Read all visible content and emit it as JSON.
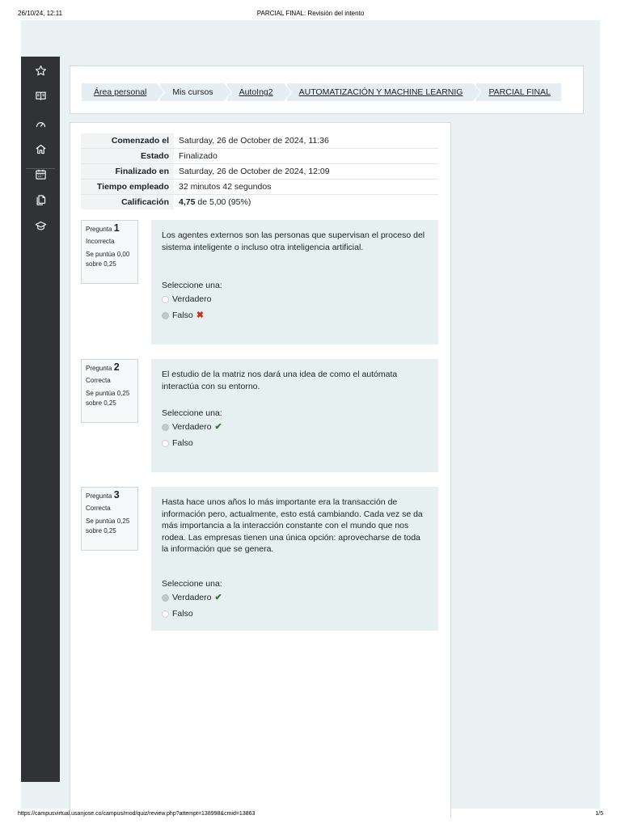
{
  "print_header": {
    "date": "26/10/24, 12:11",
    "title": "PARCIAL FINAL: Revisión del intento"
  },
  "print_footer": {
    "url": "https://campusvirtual.usanjose.co/campus/mod/quiz/review.php?attempt=138998&cmid=13863",
    "page": "1/5"
  },
  "sidebar": {
    "icons": [
      "star-icon",
      "book-icon",
      "speedometer-icon",
      "home-icon",
      "calendar-icon",
      "files-icon",
      "graduation-cap-icon"
    ]
  },
  "breadcrumb": {
    "items": [
      {
        "label": "Área personal",
        "link": true
      },
      {
        "label": "Mis cursos",
        "link": false
      },
      {
        "label": "AutoIng2",
        "link": true
      },
      {
        "label": "AUTOMATIZACIÓN Y MACHINE LEARNIG",
        "link": true
      },
      {
        "label": "PARCIAL FINAL",
        "link": true
      }
    ]
  },
  "summary": {
    "rows": [
      {
        "label": "Comenzado el",
        "value": "Saturday, 26 de October de 2024, 11:36"
      },
      {
        "label": "Estado",
        "value": "Finalizado"
      },
      {
        "label": "Finalizado en",
        "value": "Saturday, 26 de October de 2024, 12:09"
      },
      {
        "label": "Tiempo empleado",
        "value": "32 minutos 42 segundos"
      },
      {
        "label": "Calificación",
        "value_bold": "4,75",
        "value_rest": " de 5,00 (95%)"
      }
    ]
  },
  "questions": [
    {
      "prefix": "Pregunta",
      "number": "1",
      "state": "Incorrecta",
      "grade": "Se puntúa 0,00 sobre 0,25",
      "text": "Los agentes externos son las personas que supervisan el proceso del sistema inteligente o incluso otra inteligencia artificial.",
      "select_label": "Seleccione una:",
      "options": [
        {
          "label": "Verdadero",
          "checked": false,
          "mark": ""
        },
        {
          "label": "Falso",
          "checked": true,
          "mark": "✖"
        }
      ]
    },
    {
      "prefix": "Pregunta",
      "number": "2",
      "state": "Correcta",
      "grade": "Se puntúa 0,25 sobre 0,25",
      "text": "El estudio de la matriz nos dará una idea de como el autómata interactúa con su entorno.",
      "select_label": "Seleccione una:",
      "options": [
        {
          "label": "Verdadero",
          "checked": true,
          "mark": "✔"
        },
        {
          "label": "Falso",
          "checked": false,
          "mark": ""
        }
      ]
    },
    {
      "prefix": "Pregunta",
      "number": "3",
      "state": "Correcta",
      "grade": "Se puntúa 0,25 sobre 0,25",
      "text": "Hasta hace unos años lo más importante era la transacción de información pero, actualmente, esto está cambiando. Cada vez se da más importancia a la interacción constante con el mundo que nos rodea. Las empresas tienen una única opción: aprovecharse de toda la información que se genera.",
      "select_label": "Seleccione una:",
      "options": [
        {
          "label": "Verdadero",
          "checked": true,
          "mark": "✔"
        },
        {
          "label": "Falso",
          "checked": false,
          "mark": ""
        }
      ]
    }
  ]
}
